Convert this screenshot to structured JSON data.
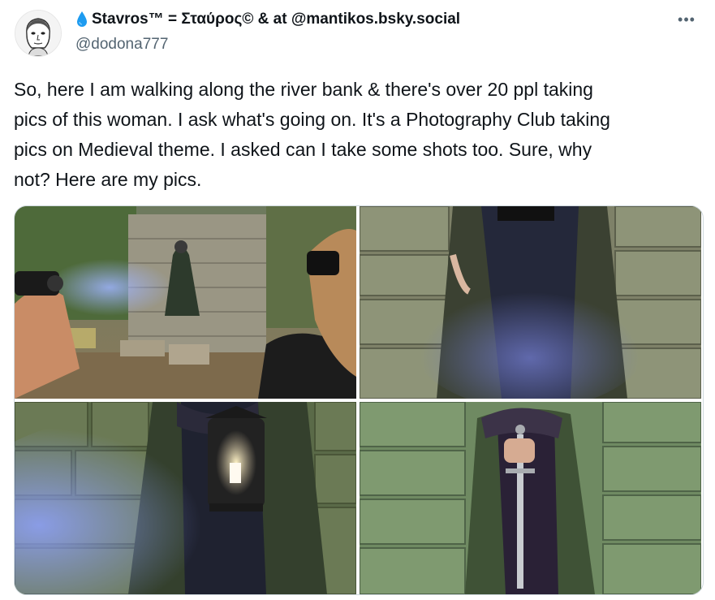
{
  "author": {
    "display_name": "Stavros™ = Σταύρος© & at @mantikos.bsky.social",
    "handle": "@dodona777",
    "name_icon": "water-drop-icon",
    "avatar": "sketch-portrait-avatar"
  },
  "menu": {
    "more_label": "•••"
  },
  "tweet": {
    "text": "So, here I am walking along the river bank & there's over 20 ppl taking\npics of this woman. I ask what's going on. It's a Photography Club taking\npics on Medieval theme. I asked can I take some shots too. Sure, why\nnot? Here are my pics."
  },
  "media": {
    "photos": [
      {
        "name": "photo-1",
        "subject": "photographers-shooting-cloaked-woman-on-stone-steps"
      },
      {
        "name": "photo-2",
        "subject": "cloaked-figure-against-stone-wall-with-blue-smoke"
      },
      {
        "name": "photo-3",
        "subject": "figure-holding-lantern-in-blue-mist"
      },
      {
        "name": "photo-4",
        "subject": "figure-holding-sword-against-mossy-wall"
      }
    ]
  },
  "colors": {
    "text": "#0f1419",
    "secondary": "#536471",
    "accent_drop": "#1d9bf0",
    "border": "#cfd9de"
  }
}
